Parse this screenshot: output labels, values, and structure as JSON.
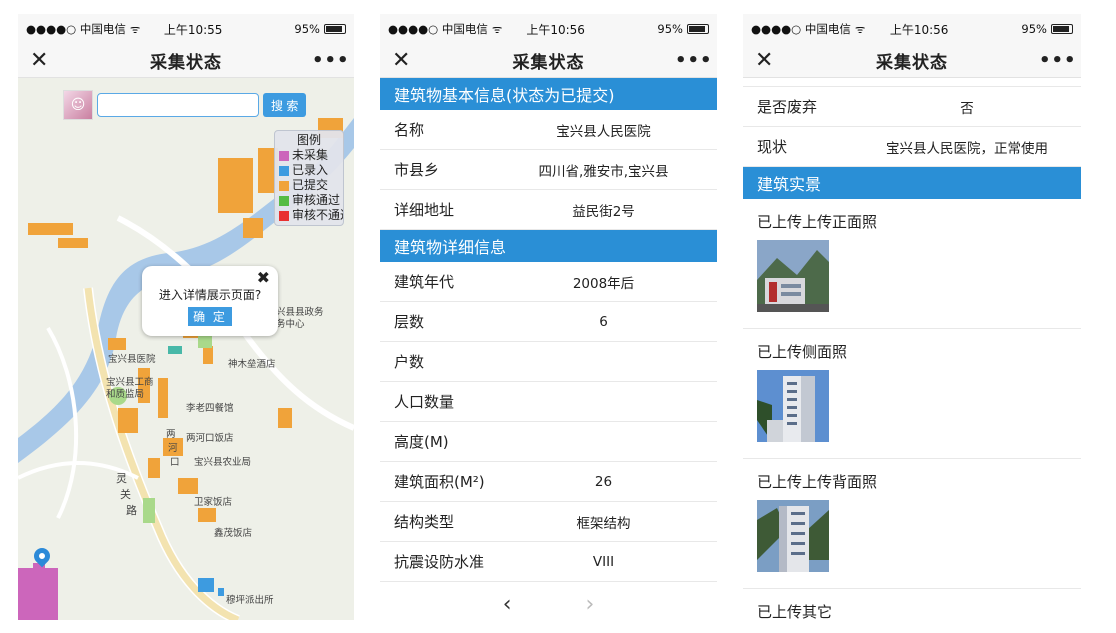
{
  "statusbar": {
    "carrier": "●●●●○ 中国电信",
    "battery": "95%",
    "times": [
      "上午10:55",
      "上午10:56",
      "上午10:56"
    ]
  },
  "nav": {
    "title": "采集状态",
    "close_label": "✕",
    "more_label": "•••"
  },
  "map_screen": {
    "search_button": "搜 索",
    "search_value": "",
    "legend": {
      "title": "图例",
      "items": [
        {
          "label": "未采集",
          "color": "#cc66bb"
        },
        {
          "label": "已录入",
          "color": "#3d9be0"
        },
        {
          "label": "已提交",
          "color": "#f0a33a"
        },
        {
          "label": "审核通过",
          "color": "#55bb44"
        },
        {
          "label": "审核不通过",
          "color": "#e83030"
        }
      ]
    },
    "popup": {
      "message": "进入详情展示页面?",
      "close": "✖",
      "confirm": "确 定"
    },
    "labels": {
      "gov_center": "兴县县政务",
      "gov_center2": "务中心",
      "hotel": "神木垒酒店",
      "hospital": "宝兴县医院",
      "industry": "宝兴县工商",
      "quality": "和质监局",
      "restaurant": "李老四餐馆",
      "liangkou": "两河口饭店",
      "agri": "宝兴县农业局",
      "family": "卫家饭店",
      "xinmao": "鑫茂饭店",
      "police": "穆坪派出所",
      "river": "宝兴",
      "road1": "两",
      "road2": "河",
      "road3": "口",
      "street": "灵",
      "street2": "关",
      "street3": "路"
    }
  },
  "detail_screen": {
    "sections": [
      {
        "title": "建筑物基本信息(状态为已提交)",
        "rows": [
          {
            "key": "名称",
            "value": "宝兴县人民医院"
          },
          {
            "key": "市县乡",
            "value": "四川省,雅安市,宝兴县"
          },
          {
            "key": "详细地址",
            "value": "益民街2号"
          }
        ]
      },
      {
        "title": "建筑物详细信息",
        "rows": [
          {
            "key": "建筑年代",
            "value": "2008年后"
          },
          {
            "key": "层数",
            "value": "6"
          },
          {
            "key": "户数",
            "value": ""
          },
          {
            "key": "人口数量",
            "value": ""
          },
          {
            "key": "高度(M)",
            "value": ""
          },
          {
            "key": "建筑面积(M²)",
            "value": "26"
          },
          {
            "key": "结构类型",
            "value": "框架结构"
          },
          {
            "key": "抗震设防水准",
            "value": "VIII"
          }
        ]
      }
    ],
    "pager": {
      "prev": "‹",
      "next": "›"
    }
  },
  "photo_screen": {
    "rows": [
      {
        "key": "是否废弃",
        "value": "否"
      },
      {
        "key": "现状",
        "value": "宝兴县人民医院，正常使用"
      }
    ],
    "section_title": "建筑实景",
    "photos": [
      {
        "label": "已上传上传正面照"
      },
      {
        "label": "已上传侧面照"
      },
      {
        "label": "已上传上传背面照"
      },
      {
        "label": "已上传其它"
      }
    ]
  }
}
